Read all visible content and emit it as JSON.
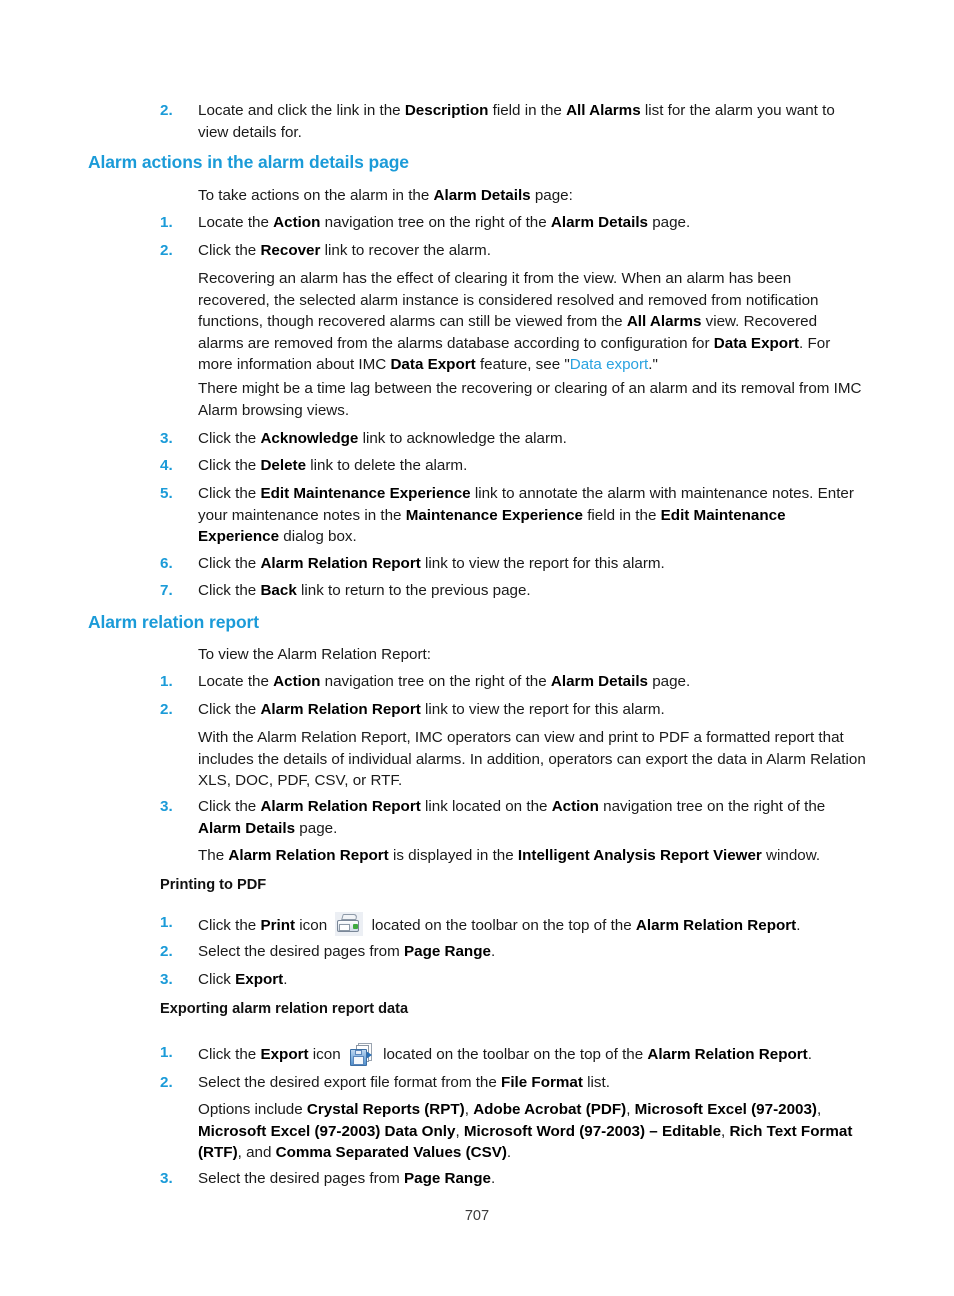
{
  "document": {
    "page_number": "707",
    "accent_color": "#1b9bd8",
    "link_color": "#2aa3e0"
  },
  "blocks": {
    "item2_top": {
      "number": "2.",
      "text_1": "Locate and click the link in the ",
      "bold_1": "Description",
      "text_2": " field in the ",
      "bold_2": "All Alarms",
      "text_3": " list for the alarm you want to view details for."
    },
    "heading_alarm_actions": "Alarm actions in the alarm details page",
    "intro_actions": {
      "text_1": "To take actions on the alarm in the ",
      "bold_1": "Alarm Details",
      "text_2": " page:"
    },
    "actions_1": {
      "number": "1.",
      "text_1": "Locate the ",
      "bold_1": "Action",
      "text_2": " navigation tree on the right of the ",
      "bold_2": "Alarm Details",
      "text_3": " page."
    },
    "actions_2": {
      "number": "2.",
      "text_1": "Click the ",
      "bold_1": "Recover",
      "text_2": " link to recover the alarm."
    },
    "recover_para": {
      "text_1": "Recovering an alarm has the effect of clearing it from the view. When an alarm has been recovered, the selected alarm instance is considered resolved and removed from notification functions, though recovered alarms can still be viewed from the ",
      "bold_1": "All Alarms",
      "text_2": " view. Recovered alarms are removed from the alarms database according to configuration for ",
      "bold_2": "Data Export",
      "text_3": ". For more information about IMC ",
      "bold_3": "Data Export",
      "text_4": " feature, see \"",
      "link_1": "Data export",
      "text_5": ".\""
    },
    "timelag_para": "There might be a time lag between the recovering or clearing of an alarm and its removal from IMC Alarm browsing views.",
    "actions_3": {
      "number": "3.",
      "text_1": "Click the ",
      "bold_1": "Acknowledge",
      "text_2": " link to acknowledge the alarm."
    },
    "actions_4": {
      "number": "4.",
      "text_1": "Click the ",
      "bold_1": "Delete",
      "text_2": " link to delete the alarm."
    },
    "actions_5": {
      "number": "5.",
      "text_1": "Click the ",
      "bold_1": "Edit Maintenance Experience",
      "text_2": " link to annotate the alarm with maintenance notes. Enter your maintenance notes in the ",
      "bold_2": "Maintenance Experience",
      "text_3": " field in the ",
      "bold_3": "Edit Maintenance Experience",
      "text_4": " dialog box."
    },
    "actions_6": {
      "number": "6.",
      "text_1": "Click the ",
      "bold_1": "Alarm Relation Report",
      "text_2": " link to view the report for this alarm."
    },
    "actions_7": {
      "number": "7.",
      "text_1": "Click the ",
      "bold_1": "Back",
      "text_2": " link to return to the previous page."
    },
    "heading_alarm_relation": "Alarm relation report",
    "intro_relation": "To view the Alarm Relation Report:",
    "relation_1": {
      "number": "1.",
      "text_1": "Locate the ",
      "bold_1": "Action",
      "text_2": " navigation tree on the right of the ",
      "bold_2": "Alarm Details",
      "text_3": " page."
    },
    "relation_2": {
      "number": "2.",
      "text_1": "Click the ",
      "bold_1": "Alarm Relation Report",
      "text_2": " link to view the report for this alarm."
    },
    "relation_para": "With the Alarm Relation Report, IMC operators can view and print to PDF a formatted report that includes the details of individual alarms. In addition, operators can export the data in Alarm Relation XLS, DOC, PDF, CSV, or RTF.",
    "relation_3": {
      "number": "3.",
      "text_1": "Click the ",
      "bold_1": "Alarm Relation Report",
      "text_2": " link located on the ",
      "bold_2": "Action",
      "text_3": " navigation tree on the right of the ",
      "bold_3": "Alarm Details",
      "text_4": " page."
    },
    "relation_result": {
      "text_1": "The ",
      "bold_1": "Alarm Relation Report",
      "text_2": " is displayed in the ",
      "bold_2": "Intelligent Analysis Report Viewer",
      "text_3": " window."
    },
    "heading_printing_pdf": "Printing to PDF",
    "print_1": {
      "number": "1.",
      "text_1": "Click the ",
      "bold_1": "Print",
      "text_2": " icon ",
      "icon": "print-icon",
      "text_3": " located on the toolbar on the top of the ",
      "bold_2": "Alarm Relation Report",
      "text_4": "."
    },
    "print_2": {
      "number": "2.",
      "text_1": "Select the desired pages from ",
      "bold_1": "Page Range",
      "text_2": "."
    },
    "print_3": {
      "number": "3.",
      "text_1": "Click ",
      "bold_1": "Export",
      "text_2": "."
    },
    "heading_exporting": "Exporting alarm relation report data",
    "export_1": {
      "number": "1.",
      "text_1": "Click the ",
      "bold_1": "Export",
      "text_2": " icon ",
      "icon": "export-icon",
      "text_3": " located on the toolbar on the top of the ",
      "bold_2": "Alarm Relation Report",
      "text_4": "."
    },
    "export_2": {
      "number": "2.",
      "text_1": "Select the desired export file format from the ",
      "bold_1": "File Format",
      "text_2": " list."
    },
    "export_options": {
      "text_1": "Options include ",
      "bold_1": "Crystal Reports (RPT)",
      "text_2": ", ",
      "bold_2": "Adobe Acrobat (PDF)",
      "text_3": ", ",
      "bold_3": "Microsoft Excel (97-2003)",
      "text_4": ", ",
      "bold_4": "Microsoft Excel (97-2003) Data Only",
      "text_5": ", ",
      "bold_5": "Microsoft Word (97-2003) – Editable",
      "text_6": ", ",
      "bold_6": "Rich Text Format (RTF)",
      "text_7": ", and ",
      "bold_7": "Comma Separated Values (CSV)",
      "text_8": "."
    },
    "export_3": {
      "number": "3.",
      "text_1": "Select the desired pages from ",
      "bold_1": "Page Range",
      "text_2": "."
    }
  }
}
